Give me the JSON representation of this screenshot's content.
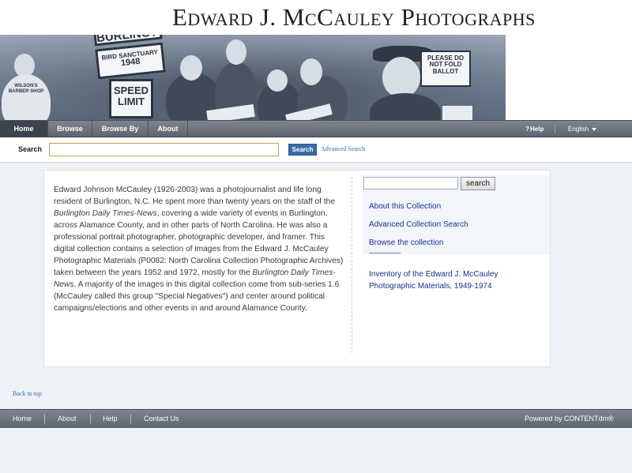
{
  "banner": {
    "title": "Edward J. McCauley Photographs",
    "sign_burlington": "BURLINGTON",
    "sign_bird": "BIRD SANCTUARY",
    "sign_year": "1948",
    "sign_speed": "SPEED",
    "sign_limit": "LIMIT",
    "sign_ballot": "PLEASE DO NOT FOLD BALLOT",
    "sign_barber": "WILSON'S BARBER SHOP"
  },
  "nav": {
    "items": [
      "Home",
      "Browse",
      "Browse By",
      "About"
    ],
    "help": "Help",
    "language": "English"
  },
  "search": {
    "label": "Search",
    "value": "",
    "button": "Search",
    "advanced": "Advanced Search"
  },
  "main": {
    "desc_1": "Edward Johnson McCauley (1926-2003) was a photojournalist and life long resident of Burlington, N.C. He spent more than twenty years on the staff of the ",
    "desc_em1": "Burlington Daily Times-News",
    "desc_2": ", covering a wide variety of events in Burlington, across Alamance County, and in other parts of North Carolina. He was also a professional portrait photographer, photographic developer, and framer. This digital collection contains a selection of images from the Edward J. McCauley Photographic Materials (P0082: North Carolina Collection Photographic Archives) taken between the years 1952 and 1972, mostly for the ",
    "desc_em2": "Burlington Daily Times-News",
    "desc_3": ". A majority of the images in this digital collection come from sub-series 1.6 (McCauley called this group \"Special Negatives\") and center around political campaigns/elections and other events in and around Alamance County."
  },
  "sidebar": {
    "search_value": "",
    "search_button": "search",
    "links": [
      "About this Collection",
      "Advanced Collection Search",
      "Browse the collection"
    ],
    "separator": "----------------",
    "inventory": "Inventory of the Edward J. McCauley Photographic Materials, 1949-1974"
  },
  "back_to_top": "Back to top",
  "footer": {
    "items": [
      "Home",
      "About",
      "Help",
      "Contact Us"
    ],
    "powered": "Powered by CONTENTdm®"
  },
  "colors": {
    "nav_bg": "#5d6570",
    "link": "#1b2f8f",
    "search_button": "#3a6da8",
    "input_border": "#c9a24a"
  }
}
